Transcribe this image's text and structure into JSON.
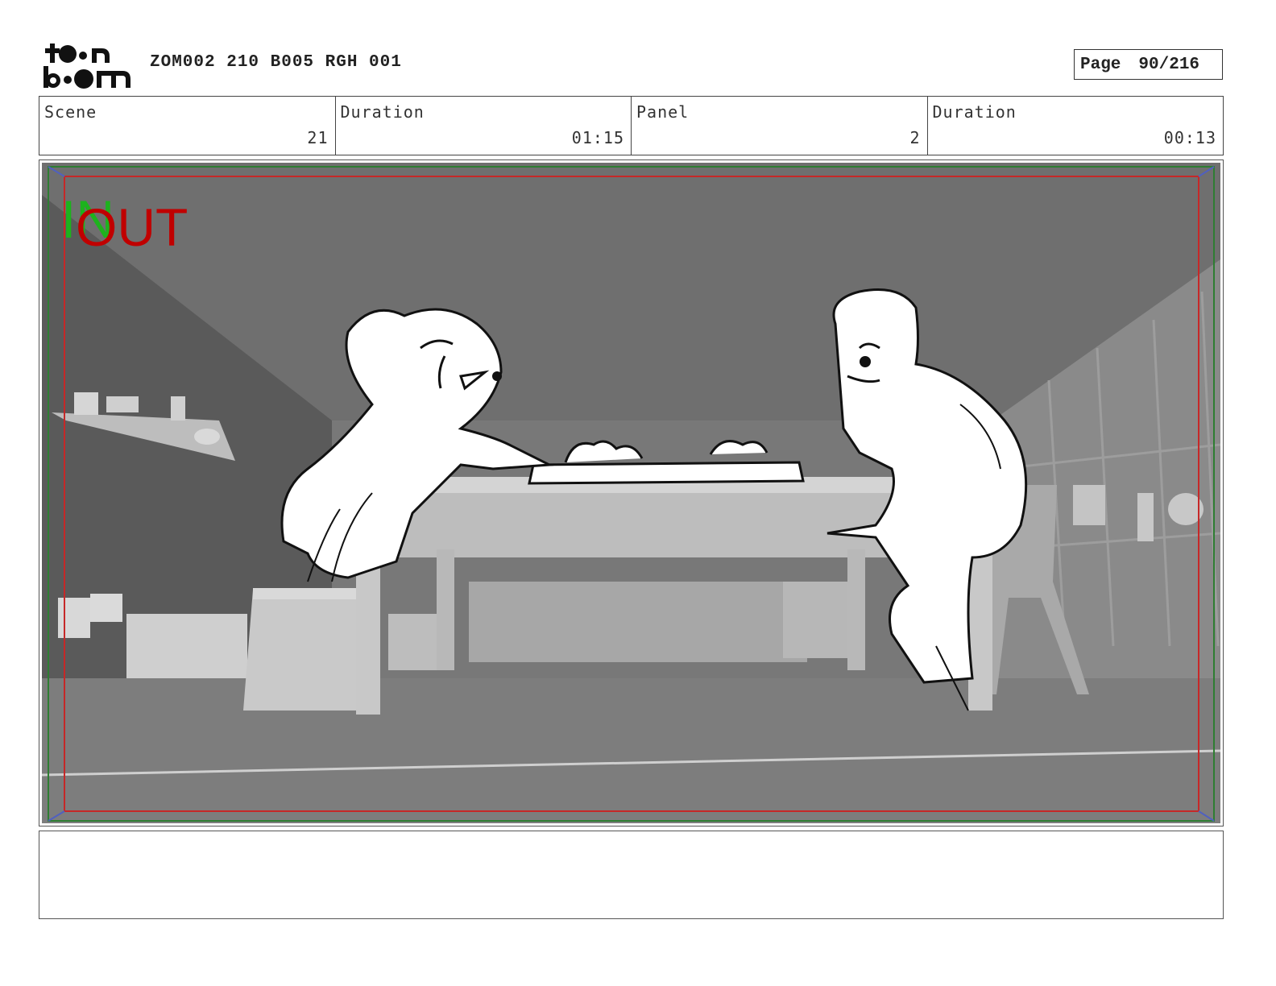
{
  "header": {
    "logo_text": "toon boom",
    "project_code": "ZOM002 210 B005 RGH 001",
    "page_label": "Page",
    "page_value": "90/216"
  },
  "info": {
    "scene_label": "Scene",
    "scene_value": "21",
    "scene_duration_label": "Duration",
    "scene_duration_value": "01:15",
    "panel_label": "Panel",
    "panel_value": "2",
    "panel_duration_label": "Duration",
    "panel_duration_value": "00:13"
  },
  "frame": {
    "in_marker": "IN",
    "out_marker": "OUT",
    "colors": {
      "safe_area_green": "#2e7d32",
      "title_safe_red": "#c62828",
      "in_green": "#1db31d",
      "out_red": "#c00000"
    }
  },
  "notes": {
    "text": ""
  }
}
